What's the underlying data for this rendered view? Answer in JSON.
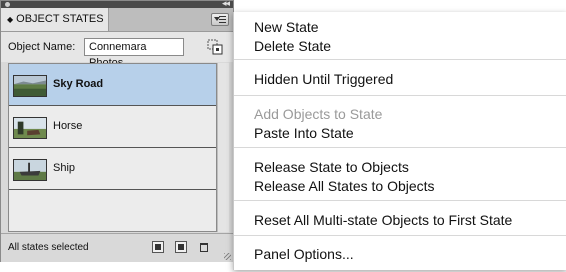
{
  "panel": {
    "tab_label": "OBJECT STATES",
    "collapse_glyph": "◂◂",
    "object_name_label": "Object Name:",
    "object_name_value": "Connemara Photos",
    "states": [
      {
        "name": "Sky Road",
        "selected": true
      },
      {
        "name": "Horse",
        "selected": false
      },
      {
        "name": "Ship",
        "selected": false
      }
    ],
    "status_text": "All states selected"
  },
  "menu": {
    "items": [
      {
        "label": "New State",
        "enabled": true
      },
      {
        "label": "Delete State",
        "enabled": true
      },
      {
        "label": "Hidden Until Triggered",
        "enabled": true
      },
      {
        "label": "Add Objects to State",
        "enabled": false
      },
      {
        "label": "Paste Into State",
        "enabled": true
      },
      {
        "label": "Release State to Objects",
        "enabled": true
      },
      {
        "label": "Release All States to Objects",
        "enabled": true
      },
      {
        "label": "Reset All Multi-state Objects to First State",
        "enabled": true
      },
      {
        "label": "Panel Options...",
        "enabled": true
      }
    ]
  },
  "colors": {
    "selection": "#b7d0ea",
    "disabled_text": "#9a9a9a"
  },
  "icons": [
    "panel-menu-icon",
    "object-state-icon",
    "new-state-icon",
    "duplicate-state-icon",
    "trash-icon"
  ]
}
